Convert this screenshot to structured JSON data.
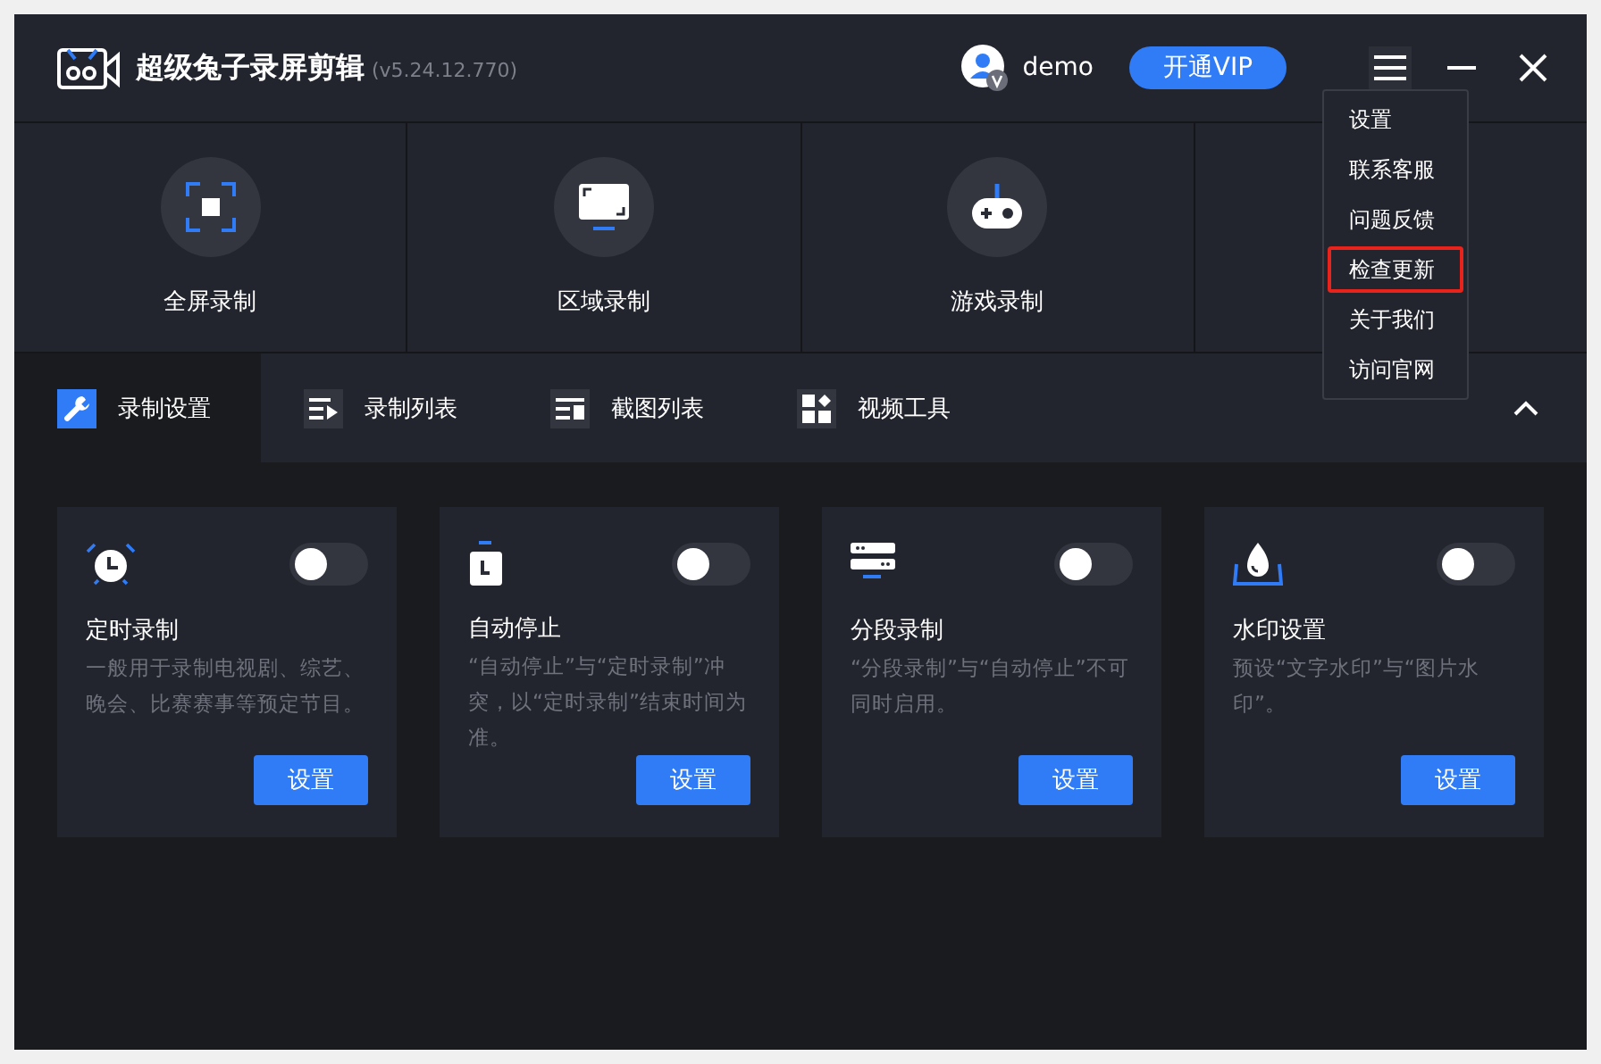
{
  "window": {
    "title": "超级兔子录屏剪辑",
    "version": "(v5.24.12.770)"
  },
  "user": {
    "name": "demo"
  },
  "vip_button": "开通VIP",
  "record_modes": [
    {
      "label": "全屏录制",
      "kind": "fullscreen"
    },
    {
      "label": "区域录制",
      "kind": "region"
    },
    {
      "label": "游戏录制",
      "kind": "game"
    },
    {
      "kind": "hidden"
    }
  ],
  "tabs": [
    {
      "label": "录制设置",
      "kind": "settings",
      "selected": true
    },
    {
      "label": "录制列表",
      "kind": "recordings",
      "selected": false
    },
    {
      "label": "截图列表",
      "kind": "screenshots",
      "selected": false
    },
    {
      "label": "视频工具",
      "kind": "tools",
      "selected": false
    }
  ],
  "cards": [
    {
      "title": "定时录制",
      "kind": "alarm",
      "on": false,
      "description": "一般用于录制电视剧、综艺、晚会、比赛赛事等预定节目。",
      "button": "设置"
    },
    {
      "title": "自动停止",
      "kind": "stop",
      "on": false,
      "description": "“自动停止”与“定时录制”冲突，以“定时录制”结束时间为准。",
      "button": "设置"
    },
    {
      "title": "分段录制",
      "kind": "segment",
      "on": false,
      "description": "“分段录制”与“自动停止”不可同时启用。",
      "button": "设置"
    },
    {
      "title": "水印设置",
      "kind": "watermark",
      "on": false,
      "description": "预设“文字水印”与“图片水印”。",
      "button": "设置"
    }
  ],
  "menu": {
    "items": [
      {
        "label": "设置",
        "selected": false
      },
      {
        "label": "联系客服",
        "selected": false
      },
      {
        "label": "问题反馈",
        "selected": false
      },
      {
        "label": "检查更新",
        "selected": true
      },
      {
        "label": "关于我们",
        "selected": false
      },
      {
        "label": "访问官网",
        "selected": false
      }
    ]
  }
}
